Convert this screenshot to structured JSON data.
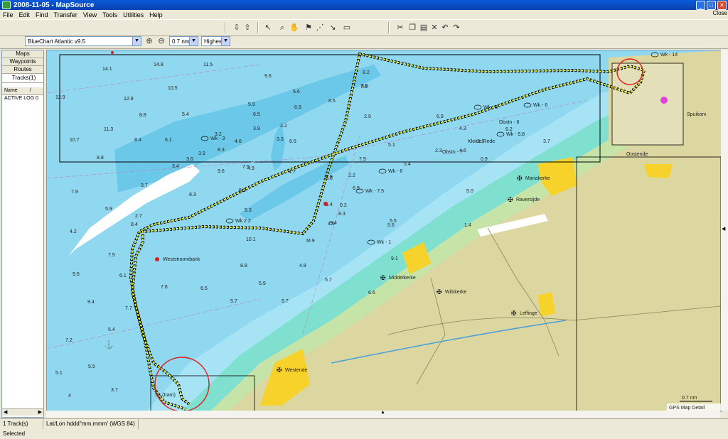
{
  "window": {
    "title": "2008-11-05 - MapSource"
  },
  "menu": [
    "File",
    "Edit",
    "Find",
    "Transfer",
    "View",
    "Tools",
    "Utilities",
    "Help"
  ],
  "close_label": "Close",
  "toolbar2": {
    "chart": "BlueChart Atlantic v9.5",
    "scale": "0.7 nm",
    "detail": "Highest"
  },
  "left_panel": {
    "tabs": [
      "Maps",
      "Waypoints",
      "Routes",
      "Tracks(1)"
    ],
    "header": {
      "name": "Name",
      "sort": "/"
    },
    "rows": [
      "ACTIVE LOG 0"
    ]
  },
  "status": {
    "selection": "1 Track(s) Selected",
    "coords": "Lat/Lon hddd°mm.mmm' (WGS 84)"
  },
  "map": {
    "places": [
      {
        "text": "Weststroombank"
      },
      {
        "text": "Middelkerke"
      },
      {
        "text": "Wilskerke"
      },
      {
        "text": "Leffinge"
      },
      {
        "text": "Mariakerke"
      },
      {
        "text": "Raversijde"
      },
      {
        "text": "Westende"
      },
      {
        "text": "Oostende"
      },
      {
        "text": "Spuikom"
      },
      {
        "text": "Kleine Rede"
      },
      {
        "text": "Ss (tram)"
      }
    ],
    "wrecks": [
      {
        "text": "Wk - 3"
      },
      {
        "text": "Wk - 6"
      },
      {
        "text": "Wk - 7.5"
      },
      {
        "text": "Wk - 6"
      },
      {
        "text": "Wk 2.2"
      },
      {
        "text": "Wk - 1"
      },
      {
        "text": "Wk - 6"
      },
      {
        "text": "Wk - 5.8"
      },
      {
        "text": "Wk - 14"
      }
    ],
    "soundings": [
      "14.1",
      "14.8",
      "11.5",
      "12.9",
      "12.8",
      "10.5",
      "8.8",
      "5.4",
      "11.3",
      "10.7",
      "8.4",
      "6.1",
      "8.8",
      "3.4",
      "7.9",
      "3.7",
      "5.9",
      "2.7",
      "4.2",
      "8.4",
      "7.5",
      "9.5",
      "6.1",
      "9.4",
      "7.7",
      "7.2",
      "5.4",
      "5.5",
      "5.1",
      "4",
      "3.7",
      "3.6",
      "9.6",
      "8.3",
      "5.3",
      "5.3",
      "10.1",
      "8.8",
      "7.6",
      "6.5",
      "5.7",
      "5.9",
      "5.7",
      "4.8",
      "6.5",
      "9.6",
      "5.6",
      "5.9",
      "6.9",
      "6.5",
      "3.2",
      "3.3",
      "3.9",
      "3.2",
      "4.6",
      "3.9",
      "8.3",
      "7.5",
      "4.9",
      "4.7",
      "8.5",
      "6.5",
      "8.2",
      "7.6",
      "2.9",
      "2.2",
      "7.9",
      "6.9",
      "6.4",
      "5.1",
      "5.4",
      "5.5",
      "5.6",
      "2.3",
      "6.9",
      "4.3",
      "4.6",
      "2.1",
      "6.2",
      "0.9",
      "3.7",
      "5.0",
      "1.4",
      "2.9",
      "0.2",
      "4.5",
      "6.6",
      "9.1",
      "9.4",
      "M.9",
      "5.7",
      "8.3",
      "5.0",
      "Obstn - 7",
      "Dbstn - 6"
    ],
    "scale_bar": "0.7 nm",
    "credit": "GPS Map Detail"
  }
}
